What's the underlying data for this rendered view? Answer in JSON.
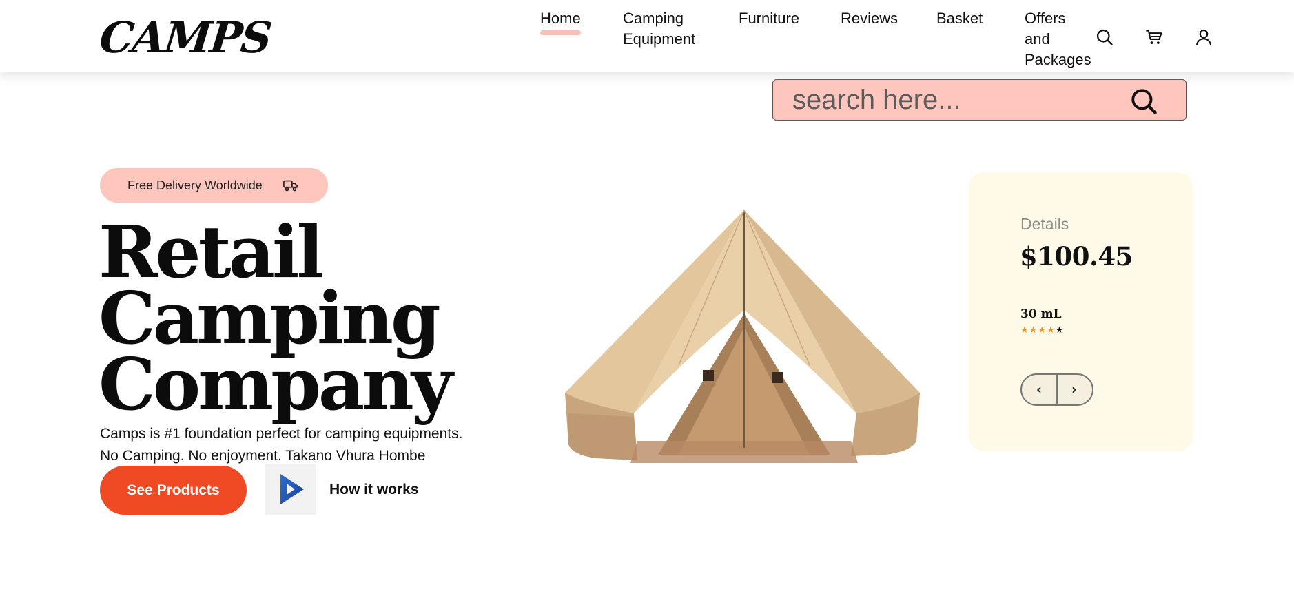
{
  "header": {
    "logo": "CAMPS",
    "nav": [
      {
        "label": "Home",
        "active": true
      },
      {
        "label": "Camping\nEquipment",
        "active": false
      },
      {
        "label": "Furniture",
        "active": false
      },
      {
        "label": "Reviews",
        "active": false
      },
      {
        "label": "Basket",
        "active": false
      },
      {
        "label": "Offers\nand\nPackages",
        "active": false
      }
    ],
    "icons": [
      "search-icon",
      "cart-icon",
      "user-icon"
    ]
  },
  "search": {
    "placeholder": "search here..."
  },
  "hero": {
    "badge": "Free Delivery Worldwide",
    "badge_icon": "truck-icon",
    "headline": [
      "Retail",
      "Camping",
      "Company"
    ],
    "desc_line1": "Camps is #1 foundation perfect for camping equipments.",
    "desc_line2": "No Camping. No enjoyment. Takano Vhura Hombe",
    "cta": "See Products",
    "how": "How it works"
  },
  "card": {
    "label": "Details",
    "price": "$100.45",
    "volume": "30 mL",
    "rating": 4,
    "rating_max": 5,
    "prev": "‹",
    "next": "›"
  },
  "colors": {
    "accent_pink": "#fec6bc",
    "cta_orange": "#f04a25",
    "card_bg": "#fff9e8",
    "star": "#e8912f"
  }
}
